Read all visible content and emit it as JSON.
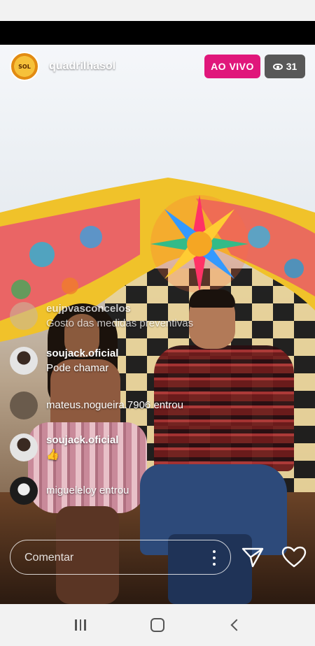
{
  "live": {
    "username": "quadrilhasol",
    "avatar_text": "SOL",
    "live_badge": "AO VIVO",
    "viewer_count": "31"
  },
  "comments": [
    {
      "user": "eujpvasconcelos",
      "message": "Gosto das medidas preventivas",
      "faded": true,
      "avatar_color": "#c9b69a"
    },
    {
      "user": "soujack.oficial",
      "message": "Pode chamar",
      "faded": false,
      "avatar_color": "#d8d8d8"
    },
    {
      "user": "",
      "message": "mateus.nogueira.7906 entrou",
      "faded": false,
      "avatar_color": "#6a5b4c"
    },
    {
      "user": "soujack.oficial",
      "message": "👍",
      "faded": false,
      "avatar_color": "#d8d8d8"
    },
    {
      "user": "",
      "message": "migueleloy entrou",
      "faded": false,
      "avatar_color": "#1c1c1c"
    }
  ],
  "composer": {
    "placeholder": "Comentar"
  },
  "icons": {
    "more": "more-vertical-icon",
    "send": "send-icon",
    "like": "heart-icon",
    "viewers": "eye-icon"
  },
  "colors": {
    "live_badge": "#e0177b",
    "viewer_badge": "#3c3c3c"
  }
}
